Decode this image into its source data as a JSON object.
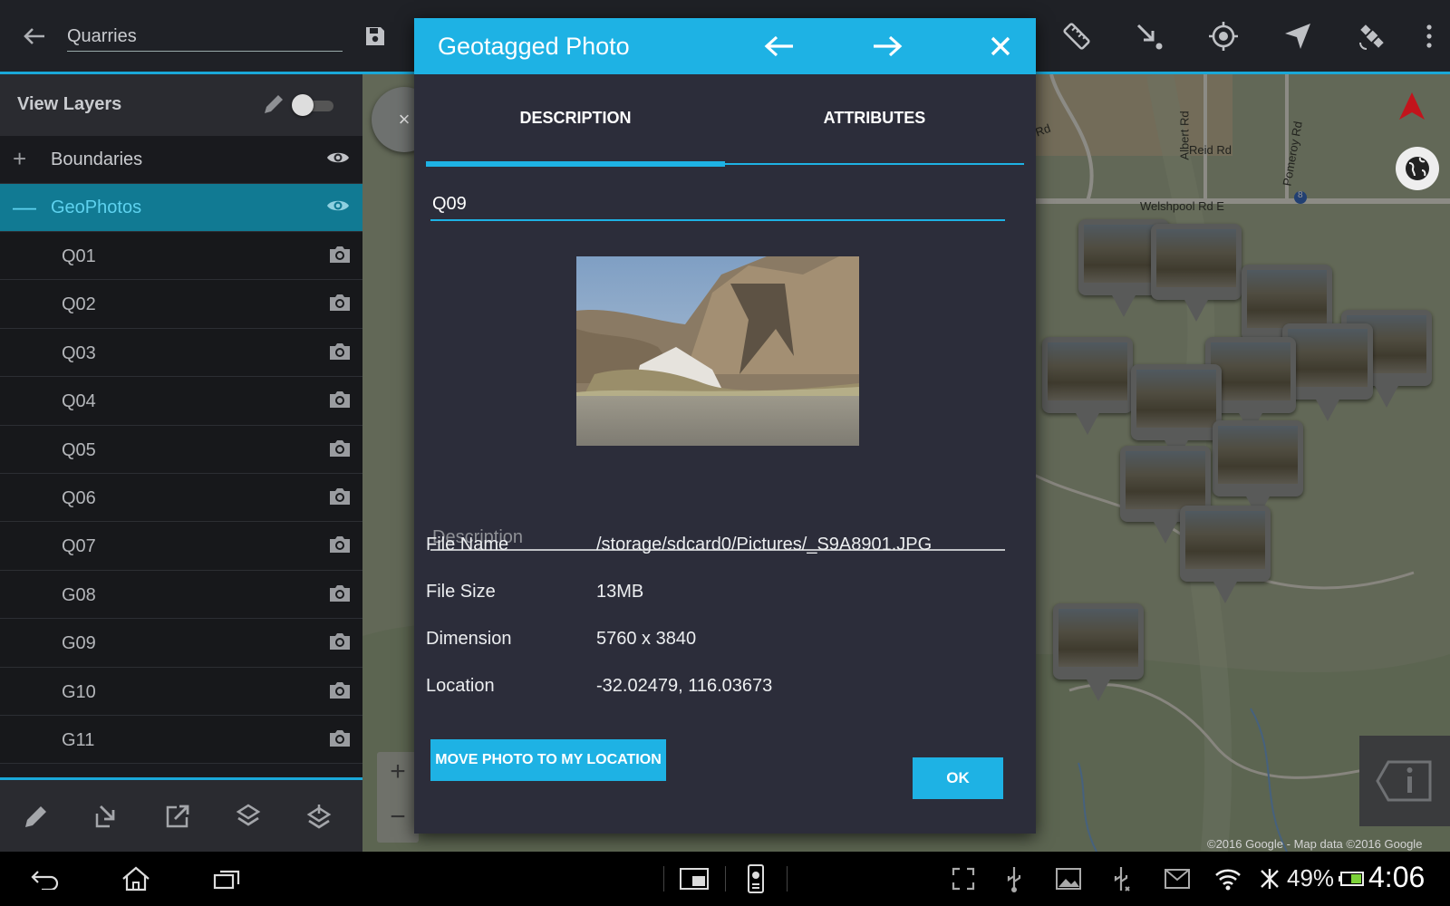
{
  "top_bar": {
    "search_value": "Quarries",
    "icons": [
      "back-arrow-icon",
      "save-icon",
      "ruler-icon",
      "draw-point-icon",
      "gps-target-icon",
      "navigation-icon",
      "satellite-icon",
      "overflow-menu-icon"
    ]
  },
  "sidebar": {
    "title": "View Layers",
    "groups": [
      {
        "label": "Boundaries",
        "expanded": false
      },
      {
        "label": "GeoPhotos",
        "expanded": true
      }
    ],
    "photos": [
      "Q01",
      "Q02",
      "Q03",
      "Q04",
      "Q05",
      "Q06",
      "Q07",
      "G08",
      "G09",
      "G10",
      "G11"
    ],
    "tools": [
      "pencil-icon",
      "import-icon",
      "export-icon",
      "layers-down-icon",
      "layers-up-icon"
    ]
  },
  "dialog": {
    "title": "Geotagged Photo",
    "tabs": [
      {
        "label": "DESCRIPTION",
        "active": true
      },
      {
        "label": "ATTRIBUTES",
        "active": false
      }
    ],
    "name_value": "Q09",
    "description_label": "Description",
    "fields": [
      {
        "key": "File Name",
        "value": "/storage/sdcard0/Pictures/_S9A8901.JPG"
      },
      {
        "key": "File Size",
        "value": "13MB"
      },
      {
        "key": "Dimension",
        "value": "5760 x 3840"
      },
      {
        "key": "Location",
        "value": "-32.02479, 116.03673"
      }
    ],
    "move_button": "MOVE PHOTO TO MY LOCATION",
    "ok_button": "OK"
  },
  "map": {
    "attribution": "©2016 Google - Map data ©2016 Google",
    "road_labels": [
      "Albert Rd",
      "Reid Rd",
      "Pomeroy Rd",
      "Welshpool Rd E",
      "a Rd"
    ],
    "route_shield": "8",
    "zoom_in": "+",
    "zoom_out": "−",
    "close_label": "×"
  },
  "status_bar": {
    "battery_pct": "49%",
    "time": "4:06"
  },
  "colors": {
    "accent": "#1eb2e4",
    "dialog_bg": "#2c2d3a",
    "sidebar_bg": "#191a1e",
    "selected_row": "#117a93"
  }
}
